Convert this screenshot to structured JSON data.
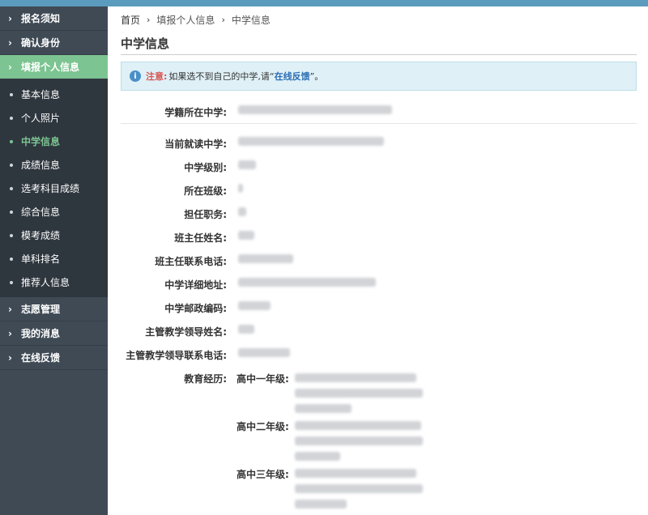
{
  "sidebar": {
    "top_items": [
      {
        "label": "报名须知"
      },
      {
        "label": "确认身份"
      },
      {
        "label": "填报个人信息"
      }
    ],
    "sub_items": [
      {
        "label": "基本信息"
      },
      {
        "label": "个人照片"
      },
      {
        "label": "中学信息"
      },
      {
        "label": "成绩信息"
      },
      {
        "label": "选考科目成绩"
      },
      {
        "label": "综合信息"
      },
      {
        "label": "模考成绩"
      },
      {
        "label": "单科排名"
      },
      {
        "label": "推荐人信息"
      }
    ],
    "bottom_items": [
      {
        "label": "志愿管理"
      },
      {
        "label": "我的消息"
      },
      {
        "label": "在线反馈"
      }
    ]
  },
  "breadcrumb": {
    "home": "首页",
    "level2": "填报个人信息",
    "level3": "中学信息"
  },
  "page": {
    "title": "中学信息"
  },
  "notice": {
    "label": "注意:",
    "text_before": "如果选不到自己的中学,请“",
    "link": "在线反馈",
    "text_after": "”。"
  },
  "form": {
    "school_registry": "学籍所在中学:",
    "current_school": "当前就读中学:",
    "school_level": "中学级别:",
    "class": "所在班级:",
    "position": "担任职务:",
    "head_teacher_name": "班主任姓名:",
    "head_teacher_phone": "班主任联系电话:",
    "school_address": "中学详细地址:",
    "postal_code": "中学邮政编码:",
    "leader_name": "主管教学领导姓名:",
    "leader_phone": "主管教学领导联系电话:",
    "education": "教育经历:",
    "grade1": "高中一年级:",
    "grade2": "高中二年级:",
    "grade3": "高中三年级:"
  }
}
